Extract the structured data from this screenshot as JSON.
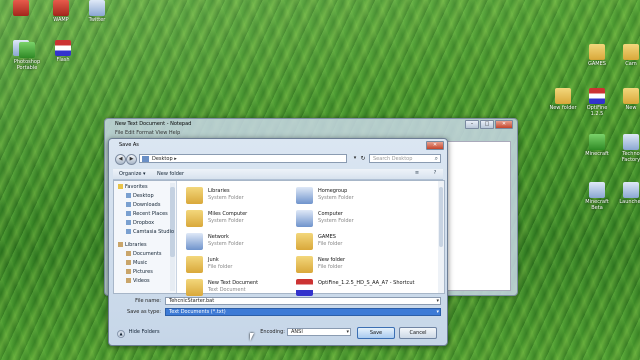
{
  "desktop": {
    "icons_left": [
      {
        "label": "",
        "kind": "red"
      },
      {
        "label": "WAMP",
        "kind": "red"
      },
      {
        "label": "Twitter",
        "kind": "app"
      },
      {
        "label": "",
        "kind": "app"
      },
      {
        "label": "Photoshop Portable",
        "kind": "green"
      },
      {
        "label": "Flash",
        "kind": "flag"
      }
    ],
    "icons_right": [
      {
        "label": "GAMES",
        "kind": "folder"
      },
      {
        "label": "Cam",
        "kind": "folder"
      },
      {
        "label": "New folder",
        "kind": "folder"
      },
      {
        "label": "OptiFine 1.2.5",
        "kind": "flag"
      },
      {
        "label": "New",
        "kind": "folder"
      },
      {
        "label": "Minecraft",
        "kind": "green"
      },
      {
        "label": "Techno Factory",
        "kind": "app"
      },
      {
        "label": "Minecraft Beta",
        "kind": "app"
      },
      {
        "label": "Launcher",
        "kind": "app"
      }
    ]
  },
  "notepad": {
    "title": "New Text Document - Notepad",
    "menu": "File  Edit  Format  View  Help",
    "btn_min": "–",
    "btn_max": "□",
    "btn_close": "✕"
  },
  "dialog": {
    "title": "Save As",
    "close": "✕",
    "back": "◀",
    "forward": "▶",
    "address": "Desktop",
    "address_sep": "▸",
    "address_dropdown": "▾",
    "refresh": "↻",
    "search_placeholder": "Search Desktop",
    "search_icon": "⌕",
    "organize": "Organize ▾",
    "new_folder": "New folder",
    "view_icon": "≡",
    "help_icon": "?",
    "nav": [
      {
        "label": "Favorites",
        "level": 0,
        "icon": "star"
      },
      {
        "label": "Desktop",
        "level": 1,
        "icon": "blue"
      },
      {
        "label": "Downloads",
        "level": 1,
        "icon": "blue"
      },
      {
        "label": "Recent Places",
        "level": 1,
        "icon": "blue"
      },
      {
        "label": "Dropbox",
        "level": 1,
        "icon": "blue"
      },
      {
        "label": "Camtasia Studio",
        "level": 1,
        "icon": "blue"
      },
      {
        "label": "Libraries",
        "level": 0,
        "icon": "lib"
      },
      {
        "label": "Documents",
        "level": 1,
        "icon": "lib"
      },
      {
        "label": "Music",
        "level": 1,
        "icon": "lib"
      },
      {
        "label": "Pictures",
        "level": 1,
        "icon": "lib"
      },
      {
        "label": "Videos",
        "level": 1,
        "icon": "lib"
      }
    ],
    "files": [
      {
        "name": "Libraries",
        "type": "System Folder",
        "kind": "folder"
      },
      {
        "name": "Homegroup",
        "type": "System Folder",
        "kind": "app"
      },
      {
        "name": "Miles Computer",
        "type": "System Folder",
        "kind": "folder"
      },
      {
        "name": "Computer",
        "type": "System Folder",
        "kind": "app"
      },
      {
        "name": "Network",
        "type": "System Folder",
        "kind": "app"
      },
      {
        "name": "GAMES",
        "type": "File folder",
        "kind": "folder"
      },
      {
        "name": "Junk",
        "type": "File folder",
        "kind": "folder"
      },
      {
        "name": "New folder",
        "type": "File folder",
        "kind": "folder"
      },
      {
        "name": "New Text Document",
        "type": "Text Document",
        "kind": "folder"
      },
      {
        "name": "OptiFine_1.2.5_HD_S_AA_A7 - Shortcut",
        "type": "",
        "kind": "flag"
      }
    ],
    "file_name_label": "File name:",
    "file_name_value": "TehcnicStarter.bat",
    "save_type_label": "Save as type:",
    "save_type_value": "Text Documents (*.txt)",
    "dropdown_arrow": "▾",
    "hide_folders": "Hide Folders",
    "hide_folders_arrow": "▲",
    "encoding_label": "Encoding:",
    "encoding_value": "ANSI",
    "save_button": "Save",
    "cancel_button": "Cancel"
  }
}
